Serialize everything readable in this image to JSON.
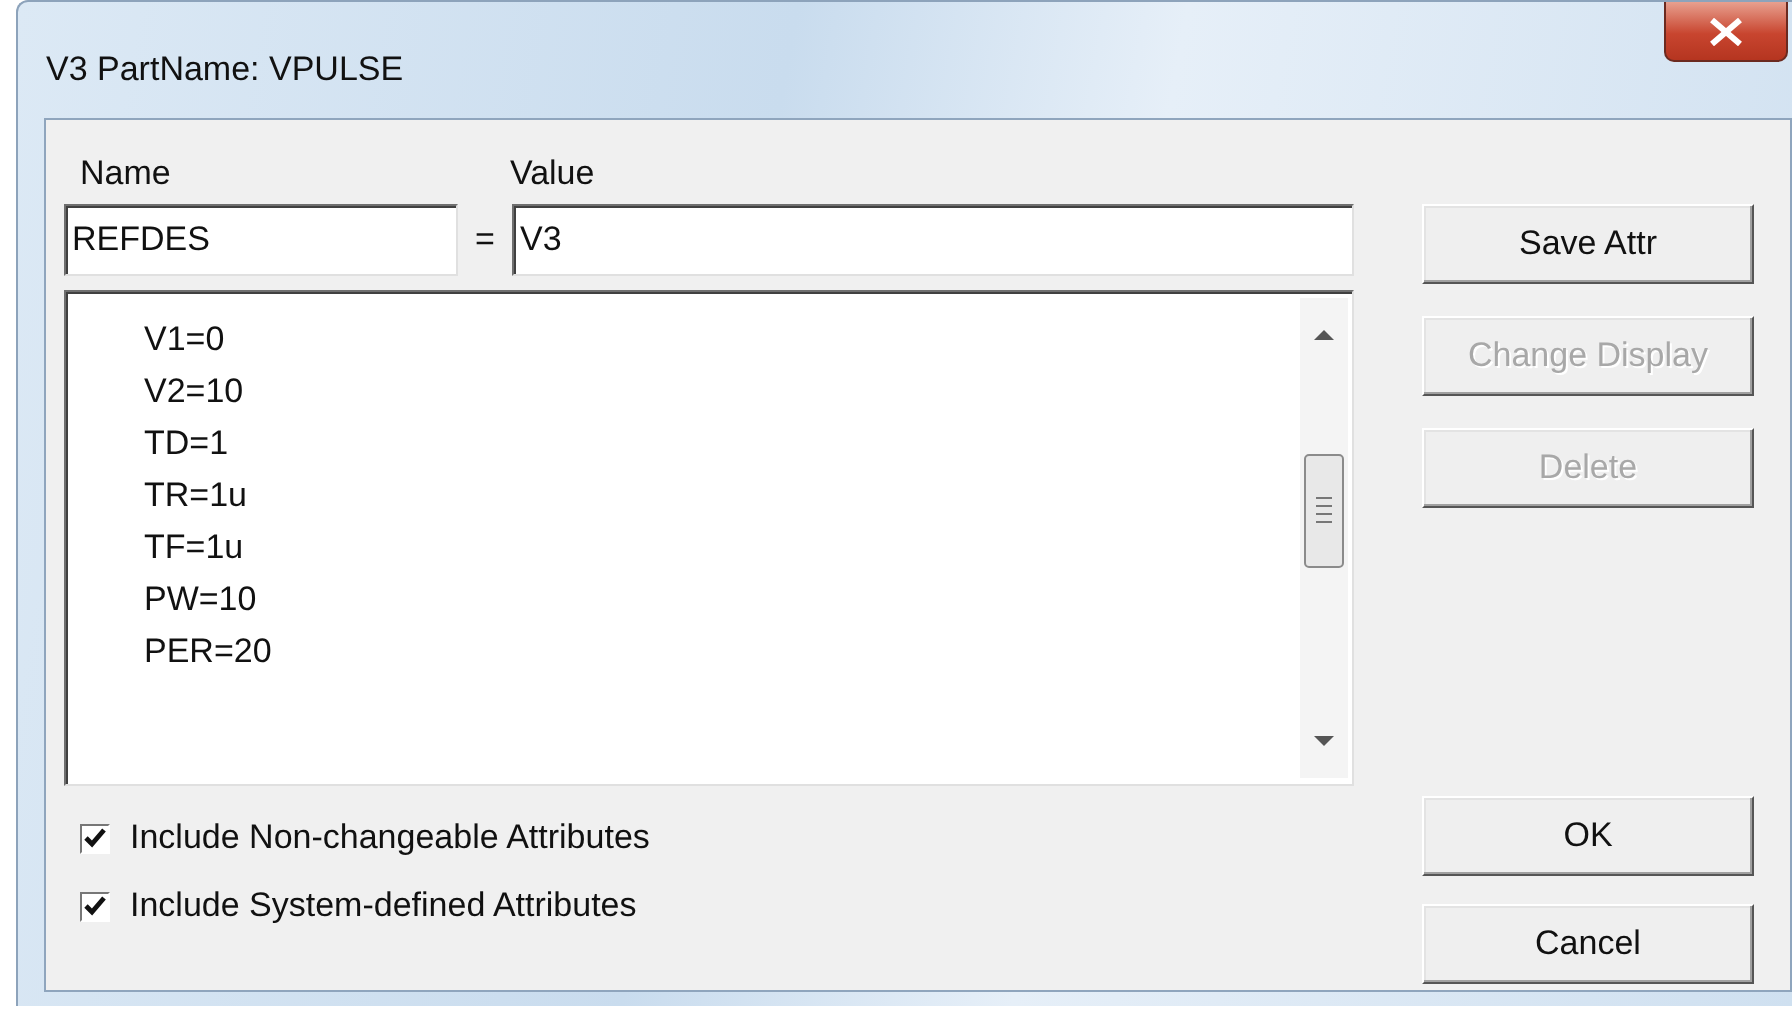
{
  "window": {
    "title": "V3   PartName: VPULSE"
  },
  "name_label": "Name",
  "value_label": "Value",
  "name_field": {
    "value": "REFDES"
  },
  "equals": "=",
  "value_field": {
    "value": "V3"
  },
  "attributes": [
    {
      "text": "V1=0",
      "selected": false
    },
    {
      "text": "V2=10",
      "selected": false
    },
    {
      "text": "TD=1",
      "selected": false
    },
    {
      "text": "TR=1u",
      "selected": false
    },
    {
      "text": "TF=1u",
      "selected": false
    },
    {
      "text": "PW=10",
      "selected": false
    },
    {
      "text": "PER=20",
      "selected": false
    }
  ],
  "side_buttons": [
    {
      "label": "Save Attr",
      "disabled": false
    },
    {
      "label": "Change Display",
      "disabled": true
    },
    {
      "label": "Delete",
      "disabled": true
    }
  ],
  "options": [
    {
      "label": "Include Non-changeable Attributes",
      "checked": true
    },
    {
      "label": "Include System-defined Attributes",
      "checked": true
    }
  ],
  "dialog_buttons": [
    {
      "label": "OK",
      "disabled": false
    },
    {
      "label": "Cancel",
      "disabled": false
    }
  ]
}
